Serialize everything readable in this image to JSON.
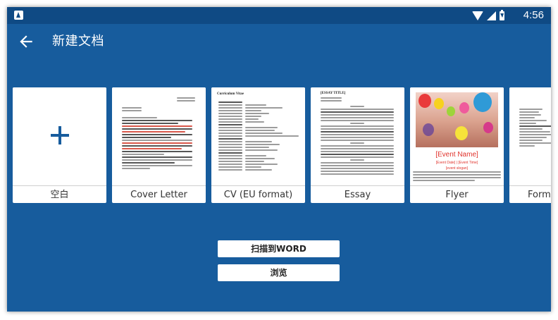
{
  "status_bar": {
    "time": "4:56",
    "icons": [
      "app-icon",
      "wifi-icon",
      "signal-icon",
      "battery-icon"
    ]
  },
  "app_bar": {
    "back_icon": "arrow-left-icon",
    "title": "新建文档"
  },
  "colors": {
    "background": "#175c9d",
    "status_bar": "#0f4a84",
    "card": "#ffffff",
    "accent_blue": "#175c9d",
    "flyer_red": "#e0322b"
  },
  "templates": [
    {
      "label": "空白",
      "icon": "plus-icon"
    },
    {
      "label": "Cover Letter"
    },
    {
      "label": "CV (EU format)",
      "heading": "Curriculum Vitae"
    },
    {
      "label": "Essay",
      "heading": "[ESSAY TITLE]"
    },
    {
      "label": "Flyer",
      "event_name": "[Event Name]",
      "event_date": "[Event Date] | [Event Time]",
      "event_slogan": "[event slogan]"
    },
    {
      "label": "Forma"
    }
  ],
  "actions": {
    "scan_label": "扫描到WORD",
    "browse_label": "浏览"
  }
}
